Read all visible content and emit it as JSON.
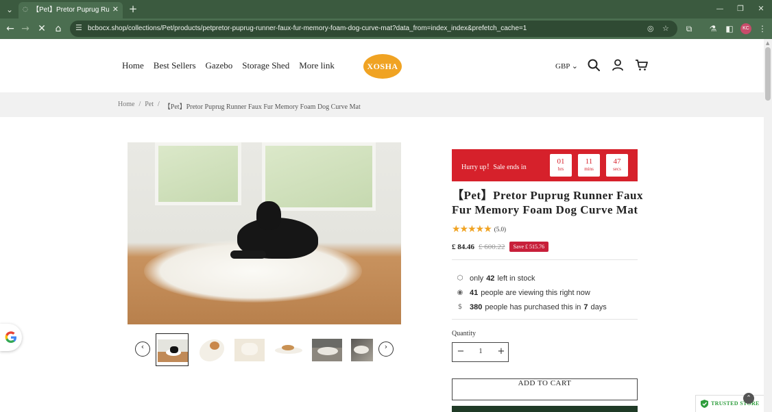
{
  "browser": {
    "tab_title": "【Pet】Pretor Puprug Runner Faux Fur Memory Foam Dog Curve Mat",
    "url": "bcbocx.shop/collections/Pet/products/petpretor-puprug-runner-faux-fur-memory-foam-dog-curve-mat?data_from=index_index&prefetch_cache=1",
    "profile_initials": "KC"
  },
  "header": {
    "nav": [
      "Home",
      "Best Sellers",
      "Gazebo",
      "Storage Shed",
      "More link"
    ],
    "logo": "XOSHA",
    "currency": "GBP"
  },
  "breadcrumb": {
    "home": "Home",
    "sep1": "/",
    "category": "Pet",
    "sep2": "/",
    "current": "【Pet】Pretor Puprug Runner Faux Fur Memory Foam Dog Curve Mat"
  },
  "countdown": {
    "label": "Hurry up！Sale ends in",
    "hours": "01",
    "hours_unit": "hrs",
    "mins": "11",
    "mins_unit": "mins",
    "secs": "47",
    "secs_unit": "secs"
  },
  "product": {
    "title": "【Pet】Pretor Puprug Runner Faux Fur Memory Foam Dog Curve Mat",
    "rating_stars": 5,
    "rating_text": "(5.0)",
    "price": "£ 84.46",
    "old_price": "£ 600.22",
    "save": "Save £ 515.76"
  },
  "stock_info": {
    "stock_pre": "only",
    "stock_count": "42",
    "stock_post": "left in stock",
    "viewing_count": "41",
    "viewing_post": "people are viewing this right now",
    "purchased_count": "380",
    "purchased_mid": "people has purchased this in",
    "purchased_days": "7",
    "purchased_post": "days"
  },
  "quantity": {
    "label": "Quantity",
    "value": "1",
    "minus": "−",
    "plus": "+"
  },
  "actions": {
    "add_to_cart": "ADD TO CART"
  },
  "badges": {
    "trusted_store": "TRUSTED STORE"
  },
  "colors": {
    "accent_red": "#d6212b",
    "star_gold": "#f0a323",
    "chrome_green": "#4b6e50",
    "trusted_green": "#2e9d3c"
  }
}
